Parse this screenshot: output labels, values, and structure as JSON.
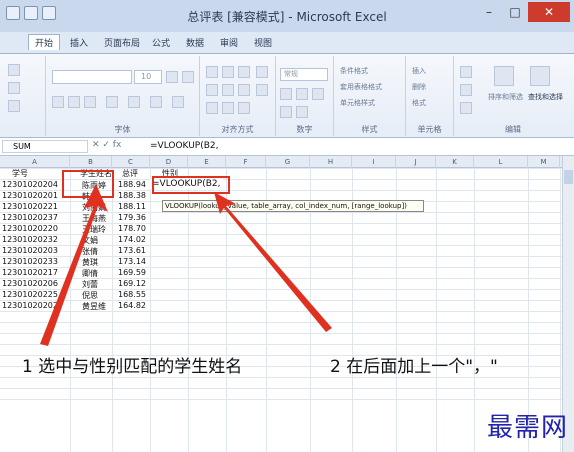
{
  "window": {
    "title": "总评表 [兼容模式] - Microsoft Excel",
    "minimize": "–",
    "restore": "□",
    "close": "✕"
  },
  "tabs": [
    "开始",
    "插入",
    "页面布局",
    "公式",
    "数据",
    "审阅",
    "视图"
  ],
  "ribbon": {
    "font_size": "10",
    "font_group": "字体",
    "align_group": "对齐方式",
    "number_group": "数字",
    "number_format": "常规",
    "style_group": "样式",
    "style_items": [
      "条件格式",
      "套用表格格式",
      "单元格样式"
    ],
    "cells_group": "单元格",
    "cells_items": [
      "插入",
      "删除",
      "格式"
    ],
    "edit_group": "编辑",
    "edit_items": [
      "排序和筛选",
      "查找和选择"
    ]
  },
  "formula_bar": {
    "name_box": "SUM",
    "icons": "✕ ✓ fx",
    "formula": "=VLOOKUP(B2,"
  },
  "columns": [
    "A",
    "B",
    "C",
    "D",
    "E",
    "F",
    "G",
    "H",
    "I",
    "J",
    "K",
    "L",
    "M"
  ],
  "sheet": {
    "headers": [
      "学号",
      "学生姓名",
      "总评",
      "性别"
    ],
    "rows": [
      [
        "12301020204",
        "陈雨婷",
        "188.94"
      ],
      [
        "12301020201",
        "韩芯",
        "188.38"
      ],
      [
        "12301020221",
        "刘丽娟",
        "188.11"
      ],
      [
        "12301020237",
        "王海燕",
        "179.36"
      ],
      [
        "12301020220",
        "王瑞玲",
        "178.70"
      ],
      [
        "12301020232",
        "文娟",
        "174.02"
      ],
      [
        "12301020203",
        "张倩",
        "173.61"
      ],
      [
        "12301020233",
        "黄琪",
        "173.14"
      ],
      [
        "12301020217",
        "卿倩",
        "169.59"
      ],
      [
        "12301020206",
        "刘蕾",
        "169.12"
      ],
      [
        "12301020225",
        "倪思",
        "168.55"
      ],
      [
        "12301020202",
        "黄昱维",
        "164.82"
      ]
    ],
    "editing_cell": "=VLOOKUP(B2,",
    "tooltip": "VLOOKUP(lookup_value, table_array, col_index_num, [range_lookup])"
  },
  "annotations": {
    "step1": "1 选中与性别匹配的学生姓名",
    "step2": "2 在后面加上一个\"，\""
  },
  "watermark": "最需网",
  "colors": {
    "arrow": "#e03020",
    "watermark": "#2222aa",
    "close": "#cc3b2c"
  }
}
